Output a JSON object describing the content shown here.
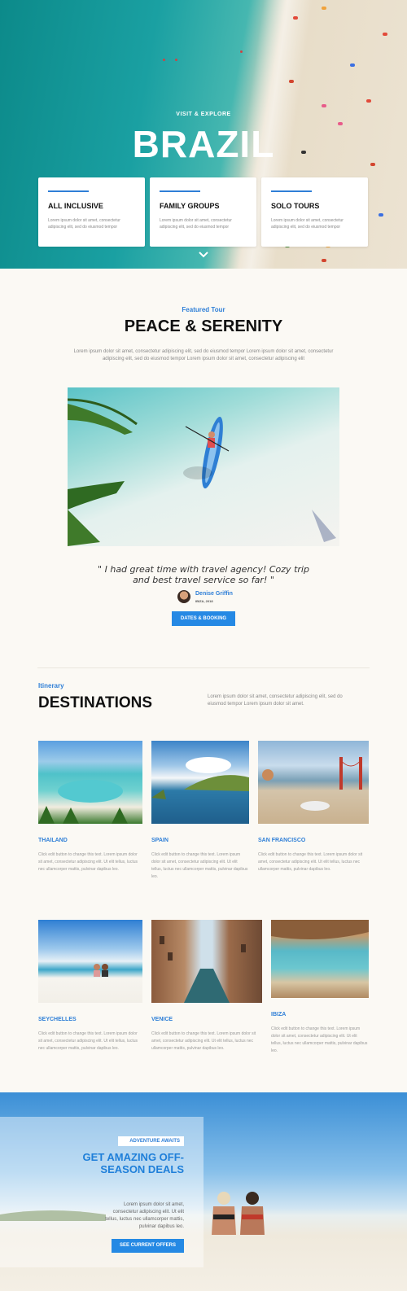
{
  "hero": {
    "kicker": "VISIT & EXPLORE",
    "title": "BRAZIL",
    "cards": [
      {
        "title": "ALL INCLUSIVE",
        "desc": "Lorem ipsum dolor sit amet, consectetur adipiscing elit, sed do eiusmod tempor"
      },
      {
        "title": "FAMILY GROUPS",
        "desc": "Lorem ipsum dolor sit amet, consectetur adipiscing elit, sed do eiusmod tempor"
      },
      {
        "title": "SOLO TOURS",
        "desc": "Lorem ipsum dolor sit amet, consectetur adipiscing elit, sed do eiusmod tempor"
      }
    ]
  },
  "featured": {
    "kicker": "Featured Tour",
    "title": "PEACE & SERENITY",
    "desc": "Lorem ipsum dolor sit amet, consectetur adipiscing elit, sed do eiusmod tempor Lorem ipsum dolor sit amet, consectetur adipiscing elit, sed do eiusmod tempor Lorem ipsum dolor sit amet, consectetur adipiscing elit",
    "quote": "\" I had great time with travel agency! Cozy trip and best travel service so far! \"",
    "author": "Denise Griffin",
    "author_sub": "IBIZA, 2018",
    "button": "DATES & BOOKING"
  },
  "destinations": {
    "kicker": "Itinerary",
    "title": "DESTINATIONS",
    "desc": "Lorem ipsum dolor sit amet, consectetur adipiscing elit, sed do eiusmod tempor Lorem ipsum dolor sit amet.",
    "items": [
      {
        "name": "THAILAND",
        "desc": "Click edit button to change this text. Lorem ipsum dolor sit amet, consectetur adipiscing elit. Ut elit tellus, luctus nec ullamcorper mattis, pulvinar dapibus leo."
      },
      {
        "name": "SPAIN",
        "desc": "Click edit button to change this text. Lorem ipsum dolor sit amet, consectetur adipiscing elit. Ut elit tellus, luctus nec ullamcorper mattis, pulvinar dapibus leo."
      },
      {
        "name": "SAN FRANCISCO",
        "desc": "Click edit button to change this text. Lorem ipsum dolor sit amet, consectetur adipiscing elit. Ut elit tellus, luctus nec ullamcorper mattis, pulvinar dapibus leo."
      },
      {
        "name": "SEYCHELLES",
        "desc": "Click edit button to change this text. Lorem ipsum dolor sit amet, consectetur adipiscing elit. Ut elit tellus, luctus nec ullamcorper mattis, pulvinar dapibus leo."
      },
      {
        "name": "VENICE",
        "desc": "Click edit button to change this text. Lorem ipsum dolor sit amet, consectetur adipiscing elit. Ut elit tellus, luctus nec ullamcorper mattis, pulvinar dapibus leo."
      },
      {
        "name": "IBIZA",
        "desc": "Click edit button to change this text. Lorem ipsum dolor sit amet, consectetur adipiscing elit. Ut elit tellus, luctus nec ullamcorper mattis, pulvinar dapibus leo."
      }
    ]
  },
  "banner": {
    "kicker": "ADVENTURE AWAITS",
    "title": "GET AMAZING OFF-SEASON DEALS",
    "desc": "Lorem ipsum dolor sit amet, consectetur adipiscing elit. Ut elit tellus, luctus nec ullamcorper mattis, pulvinar dapibus leo.",
    "button": "SEE CURRENT OFFERS"
  },
  "colors": {
    "accent": "#2f7fd7",
    "button": "#2589e4",
    "background": "#fbf9f4"
  },
  "icons": {
    "scroll_down": "chevron-down-icon"
  }
}
